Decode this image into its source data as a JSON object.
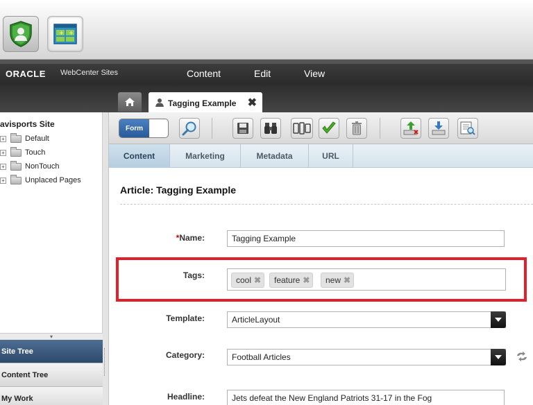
{
  "header": {
    "brand": "ORACLE",
    "product": "WebCenter Sites",
    "menu": [
      "Content",
      "Edit",
      "View"
    ]
  },
  "apps": [
    {
      "name": "user-app",
      "icon": "shield-user-icon"
    },
    {
      "name": "sites-app",
      "icon": "grid-plus-icon"
    }
  ],
  "tabs": {
    "home_icon": "home-icon",
    "document": {
      "label": "Tagging Example",
      "icon": "person-icon",
      "close": "✖"
    }
  },
  "site_tree": {
    "title": "avisports Site",
    "items": [
      {
        "label": "Default",
        "expander": "+"
      },
      {
        "label": "Touch",
        "expander": "+"
      },
      {
        "label": "NonTouch",
        "expander": "+"
      },
      {
        "label": "Unplaced Pages",
        "expander": "+"
      }
    ]
  },
  "left_nav": {
    "collapse_arrow": "▾",
    "sections": [
      "Site Tree",
      "Content Tree",
      "My Work"
    ],
    "active": "Site Tree"
  },
  "toolbar": {
    "form_toggle_label": "Form",
    "buttons": [
      "search-icon",
      "save-icon",
      "binoculars-icon",
      "devices-icon",
      "approve-icon",
      "delete-icon",
      "publish-icon",
      "import-icon",
      "preview-icon"
    ]
  },
  "subtabs": [
    "Content",
    "Marketing",
    "Metadata",
    "URL"
  ],
  "form": {
    "title": "Article: Tagging Example",
    "fields": {
      "name": {
        "required_mark": "*",
        "label": "Name:",
        "value": "Tagging Example"
      },
      "tags": {
        "label": "Tags:",
        "values": [
          "cool",
          "feature",
          "new"
        ]
      },
      "template": {
        "label": "Template:",
        "value": "ArticleLayout"
      },
      "category": {
        "label": "Category:",
        "value": "Football Articles"
      },
      "headline": {
        "label": "Headline:",
        "value": "Jets defeat the New England Patriots 31-17 in the Fog"
      }
    }
  },
  "colors": {
    "highlight": "#e0202a",
    "active_nav": "#2d4a6d",
    "required": "#c00000",
    "form_toggle": "#2a5a98"
  }
}
